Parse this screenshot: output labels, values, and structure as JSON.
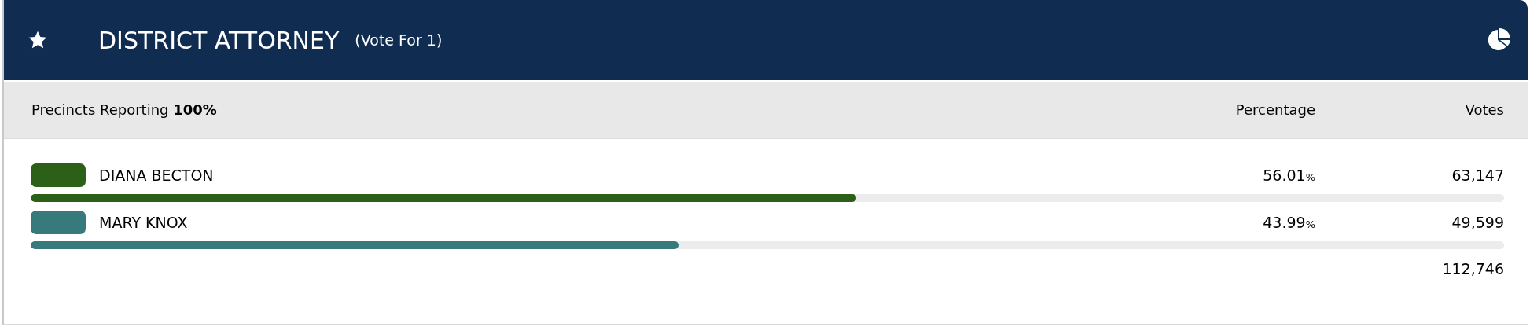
{
  "header": {
    "title": "DISTRICT ATTORNEY",
    "subtitle": "(Vote For 1)"
  },
  "columns": {
    "reporting": "Precincts Reporting **100%**",
    "percentage": "Percentage",
    "votes": "Votes"
  },
  "candidates": [
    {
      "name": "DIANA BECTON",
      "color": "#2c5f17",
      "percent": "56.01",
      "percent_unit": "%",
      "votes": "63,147",
      "level": 0.5601
    },
    {
      "name": "MARY KNOX",
      "color": "#367a7c",
      "percent": "43.99",
      "percent_unit": "%",
      "votes": "49,599",
      "level": 0.4399
    }
  ],
  "total_votes": "112,746"
}
